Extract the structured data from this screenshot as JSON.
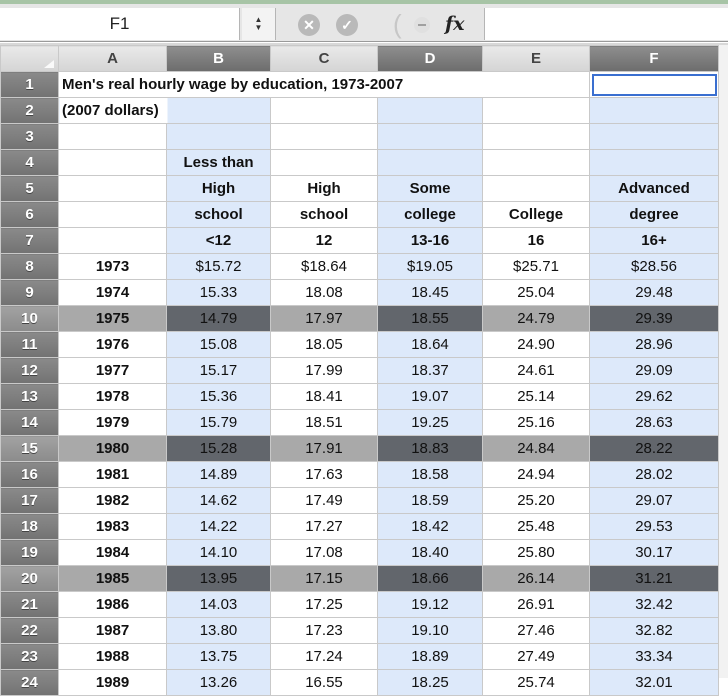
{
  "formula_bar": {
    "name_box": "F1",
    "formula_value": "",
    "fx_label": "fx",
    "cancel_icon": "cancel-x-icon",
    "confirm_icon": "confirm-check-icon"
  },
  "columns": [
    "A",
    "B",
    "C",
    "D",
    "E",
    "F"
  ],
  "selected_columns": [
    "B",
    "D",
    "F"
  ],
  "active_cell": "F1",
  "rows_header": [
    "1",
    "2",
    "3",
    "4",
    "5",
    "6",
    "7",
    "8",
    "9",
    "10",
    "11",
    "12",
    "13",
    "14",
    "15",
    "16",
    "17",
    "18",
    "19",
    "20",
    "21",
    "22",
    "23",
    "24"
  ],
  "highlighted_rows": [
    "10",
    "15",
    "20"
  ],
  "sheet": {
    "title": "Men's real hourly wage by education, 1973-2007",
    "subtitle": "(2007 dollars)",
    "headers": {
      "row4": [
        "",
        "Less than",
        "",
        "",
        "",
        ""
      ],
      "row5": [
        "",
        "High",
        "High",
        "Some",
        "",
        "Advanced"
      ],
      "row6": [
        "",
        "school",
        "school",
        "college",
        "College",
        "degree"
      ],
      "row7": [
        "",
        "<12",
        "12",
        "13-16",
        "16",
        "16+"
      ]
    },
    "data": [
      [
        "1973",
        "$15.72",
        "$18.64",
        "$19.05",
        "$25.71",
        "$28.56"
      ],
      [
        "1974",
        "15.33",
        "18.08",
        "18.45",
        "25.04",
        "29.48"
      ],
      [
        "1975",
        "14.79",
        "17.97",
        "18.55",
        "24.79",
        "29.39"
      ],
      [
        "1976",
        "15.08",
        "18.05",
        "18.64",
        "24.90",
        "28.96"
      ],
      [
        "1977",
        "15.17",
        "17.99",
        "18.37",
        "24.61",
        "29.09"
      ],
      [
        "1978",
        "15.36",
        "18.41",
        "19.07",
        "25.14",
        "29.62"
      ],
      [
        "1979",
        "15.79",
        "18.51",
        "19.25",
        "25.16",
        "28.63"
      ],
      [
        "1980",
        "15.28",
        "17.91",
        "18.83",
        "24.84",
        "28.22"
      ],
      [
        "1981",
        "14.89",
        "17.63",
        "18.58",
        "24.94",
        "28.02"
      ],
      [
        "1982",
        "14.62",
        "17.49",
        "18.59",
        "25.20",
        "29.07"
      ],
      [
        "1983",
        "14.22",
        "17.27",
        "18.42",
        "25.48",
        "29.53"
      ],
      [
        "1984",
        "14.10",
        "17.08",
        "18.40",
        "25.80",
        "30.17"
      ],
      [
        "1985",
        "13.95",
        "17.15",
        "18.66",
        "26.14",
        "31.21"
      ],
      [
        "1986",
        "14.03",
        "17.25",
        "19.12",
        "26.91",
        "32.42"
      ],
      [
        "1987",
        "13.80",
        "17.23",
        "19.10",
        "27.46",
        "32.82"
      ],
      [
        "1988",
        "13.75",
        "17.24",
        "18.89",
        "27.49",
        "33.34"
      ],
      [
        "1989",
        "13.26",
        "16.55",
        "18.25",
        "25.74",
        "32.01"
      ]
    ]
  },
  "colors": {
    "selected_column_fill": "#dde9fa",
    "highlight_row_fill": "#a9a9a9",
    "highlight_intersection_fill": "#62666c",
    "active_cell_border": "#3a6fd0"
  }
}
